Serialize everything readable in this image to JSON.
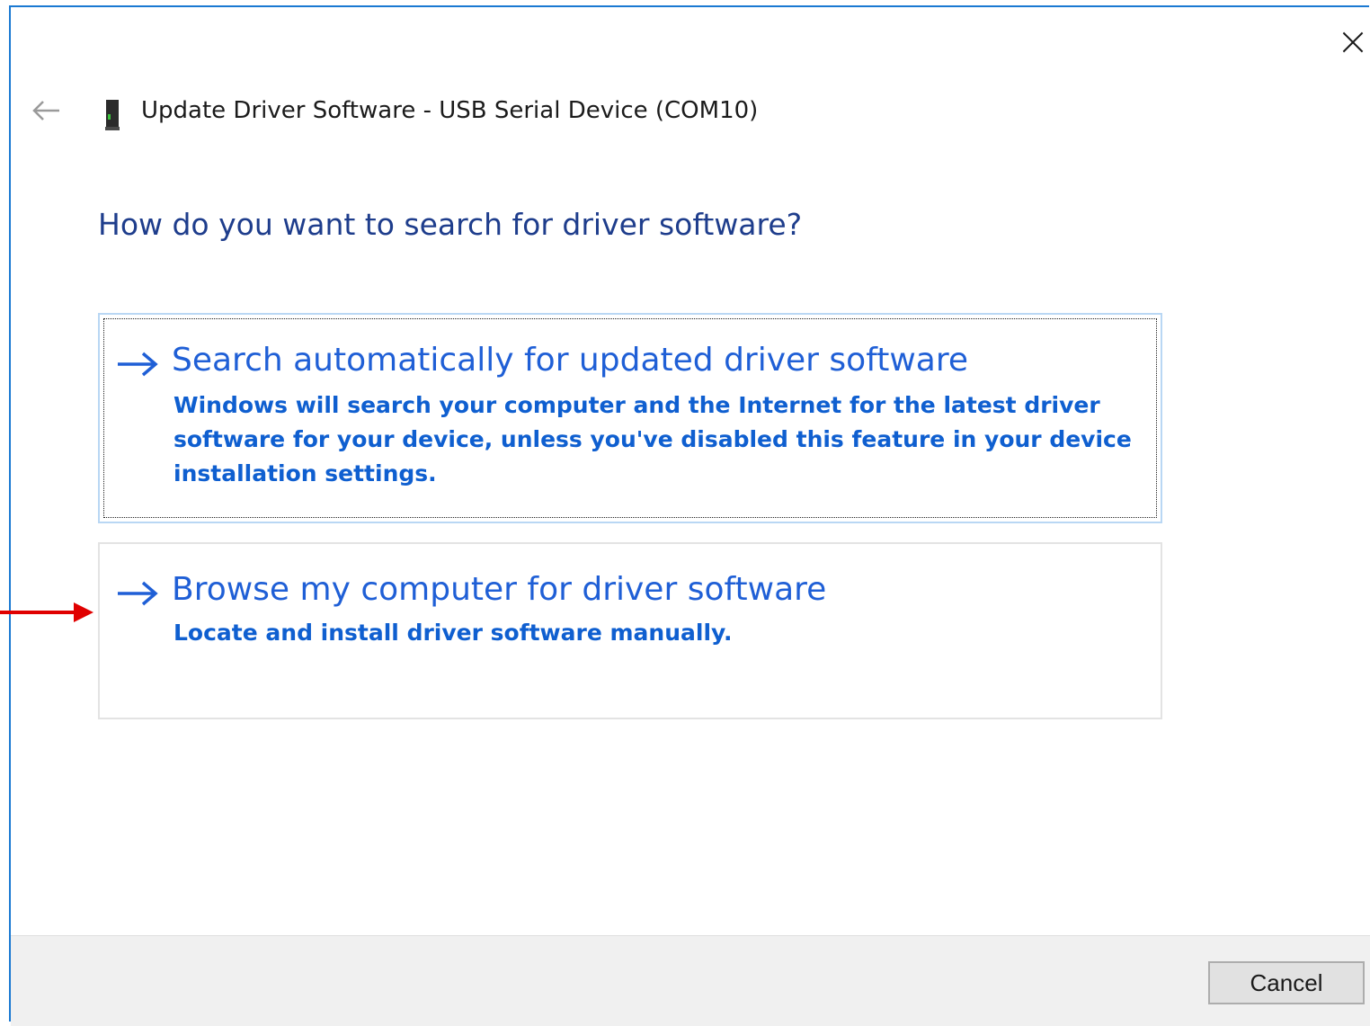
{
  "dialog": {
    "back_icon": "back-arrow-icon",
    "device_icon": "usb-device-icon",
    "title": "Update Driver Software - USB Serial Device (COM10)",
    "close_icon": "close-icon"
  },
  "heading": "How do you want to search for driver software?",
  "options": [
    {
      "title": "Search automatically for updated driver software",
      "description": "Windows will search your computer and the Internet for the latest driver software for your device, unless you've disabled this feature in your device installation settings.",
      "icon": "right-arrow-icon",
      "selected": true
    },
    {
      "title": "Browse my computer for driver software",
      "description": "Locate and install driver software manually.",
      "icon": "right-arrow-icon",
      "selected": false
    }
  ],
  "annotation": {
    "icon": "red-pointer-arrow",
    "color": "#e00000"
  },
  "footer": {
    "cancel_label": "Cancel"
  },
  "colors": {
    "window_border": "#1a79d2",
    "heading": "#1e3d8c",
    "link": "#1f5fd6",
    "selected_border": "#b9d7f4",
    "footer_bg": "#f0f0f0"
  }
}
